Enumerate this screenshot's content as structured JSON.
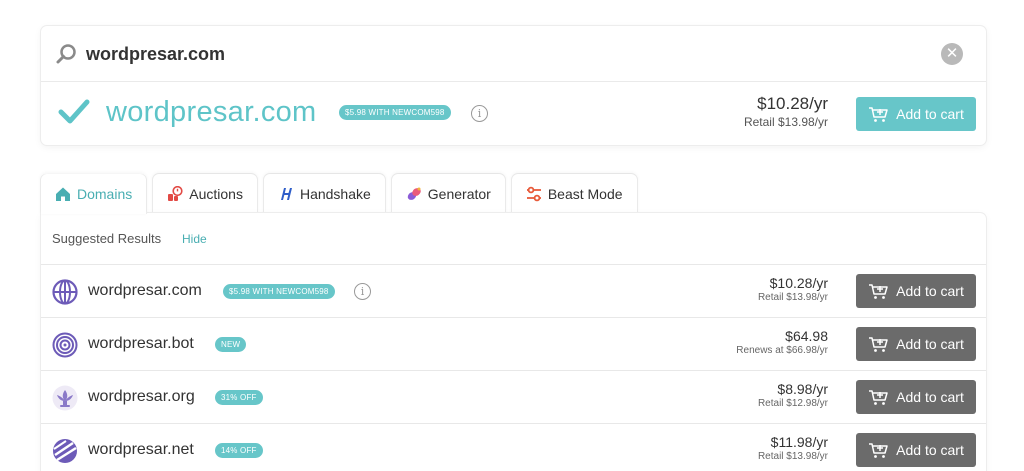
{
  "search": {
    "query": "wordpresar.com",
    "icon": "search-icon",
    "clear_icon": "close-icon"
  },
  "primary_result": {
    "domain": "wordpresar.com",
    "promo": "$5.98 WITH NEWCOM598",
    "info": "i",
    "price": "$10.28/yr",
    "retail": "Retail $13.98/yr",
    "button": "Add to cart"
  },
  "tabs": [
    {
      "label": "Domains",
      "icon": "home-icon"
    },
    {
      "label": "Auctions",
      "icon": "auction-icon"
    },
    {
      "label": "Handshake",
      "icon": "handshake-icon"
    },
    {
      "label": "Generator",
      "icon": "generator-icon"
    },
    {
      "label": "Beast Mode",
      "icon": "sliders-icon"
    }
  ],
  "suggested": {
    "title": "Suggested Results",
    "hide": "Hide"
  },
  "rows": [
    {
      "domain": "wordpresar.com",
      "badge": "$5.98 WITH NEWCOM598",
      "info": "i",
      "price": "$10.28/yr",
      "sub": "Retail $13.98/yr",
      "button": "Add to cart",
      "icon": "globe-icon"
    },
    {
      "domain": "wordpresar.bot",
      "badge": "NEW",
      "price": "$64.98",
      "sub": "Renews at $66.98/yr",
      "button": "Add to cart",
      "icon": "target-icon"
    },
    {
      "domain": "wordpresar.org",
      "badge": "31% OFF",
      "price": "$8.98/yr",
      "sub": "Retail $12.98/yr",
      "button": "Add to cart",
      "icon": "lotus-icon"
    },
    {
      "domain": "wordpresar.net",
      "badge": "14% OFF",
      "price": "$11.98/yr",
      "sub": "Retail $13.98/yr",
      "button": "Add to cart",
      "icon": "net-icon"
    }
  ],
  "colors": {
    "accent": "#67c6c9",
    "accent_text": "#5ec4c8",
    "dark_button": "#6b6b6b"
  }
}
